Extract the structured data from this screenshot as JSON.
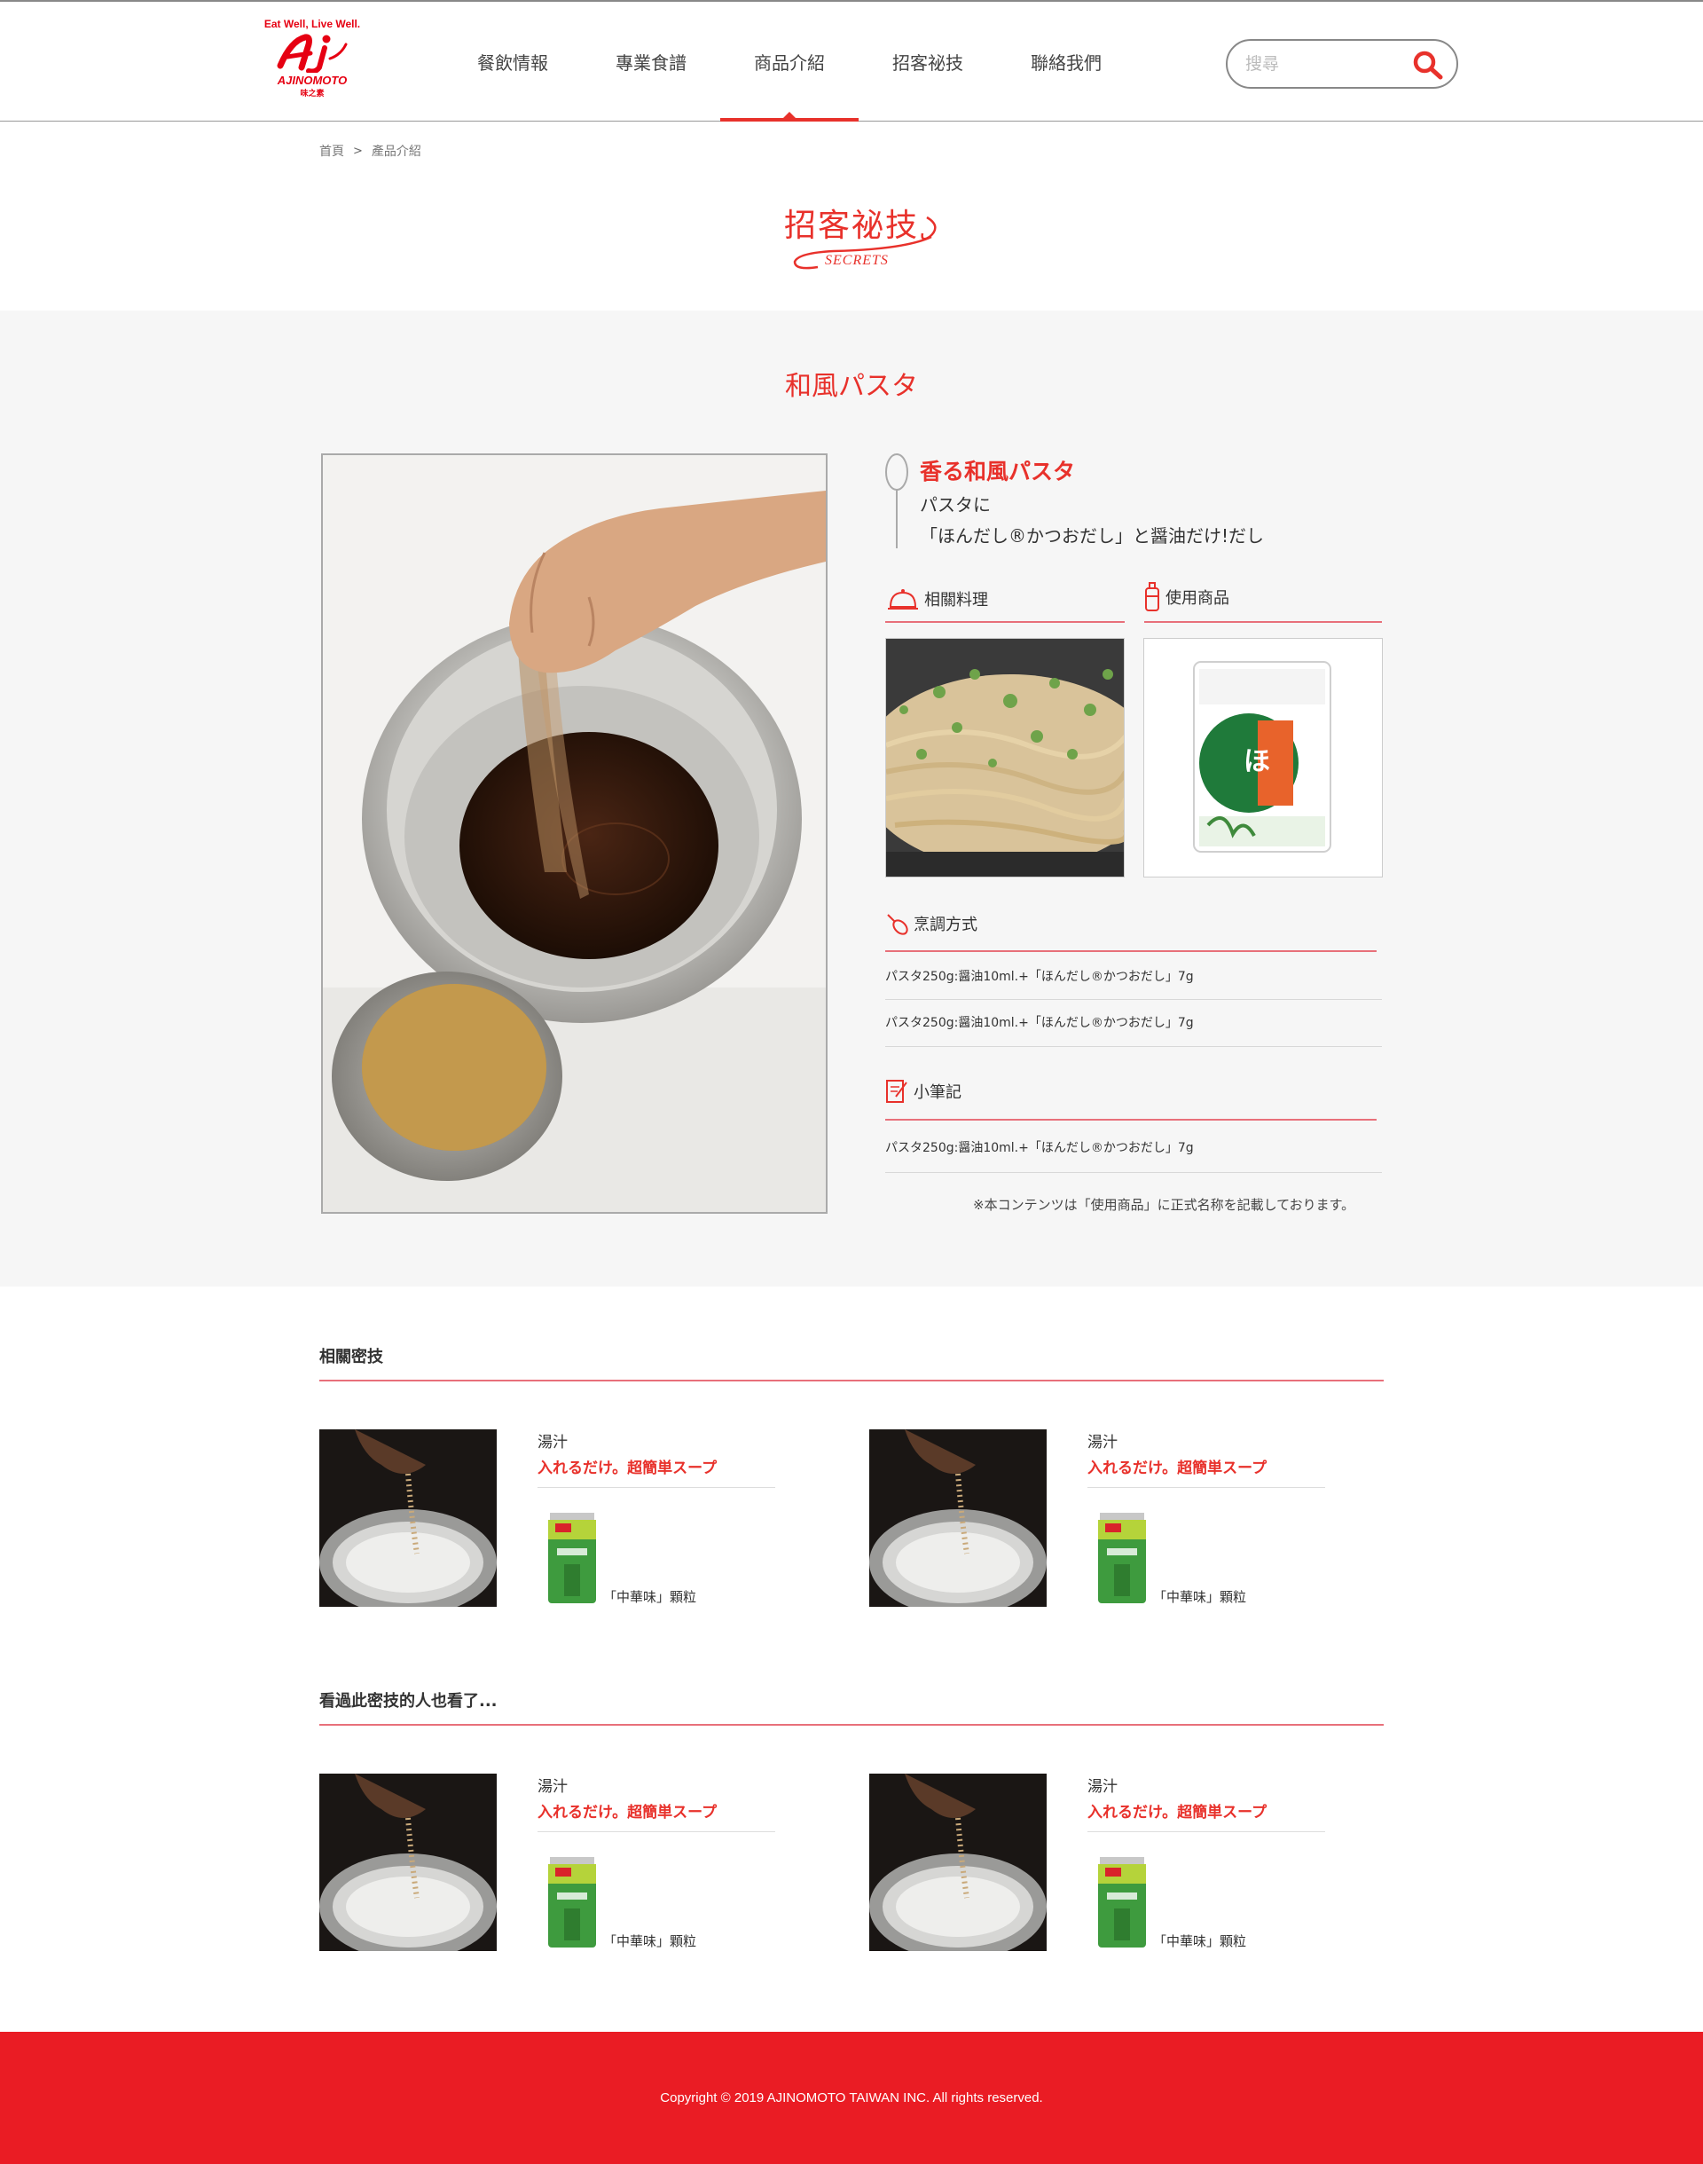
{
  "header": {
    "logo_tagline": "Eat Well, Live Well.",
    "logo_brand": "AJINOMOTO",
    "logo_brand_sub": "味之素",
    "nav": [
      {
        "label": "餐飲情報"
      },
      {
        "label": "專業食譜"
      },
      {
        "label": "商品介紹"
      },
      {
        "label": "招客祕技"
      },
      {
        "label": "聯絡我們"
      }
    ],
    "active_nav": "商品介紹",
    "search_placeholder": "搜尋"
  },
  "breadcrumb": {
    "home": "首頁",
    "separator": ">",
    "current": "產品介紹"
  },
  "page_title": {
    "cn": "招客祕技",
    "en": "SECRETS"
  },
  "main": {
    "heading": "和風パスタ",
    "tip_title": "香る和風パスタ",
    "tip_line1": "パスタに",
    "tip_line2": "「ほんだし®かつおだし」と醤油だけ!だし",
    "related_dish_label": "相關料理",
    "used_product_label": "使用商品",
    "cooking_method_label": "烹調方式",
    "cooking_steps": [
      "パスタ250g:醤油10ml.+「ほんだし®かつおだし」7g",
      "パスタ250g:醤油10ml.+「ほんだし®かつおだし」7g"
    ],
    "notes_label": "小筆記",
    "notes": [
      "パスタ250g:醤油10ml.+「ほんだし®かつおだし」7g"
    ],
    "disclaimer": "※本コンテンツは「使用商品」に正式名称を記載しております。",
    "product_package_text": "ほんだし"
  },
  "related_secrets": {
    "heading": "相關密技",
    "cards": [
      {
        "category": "湯汁",
        "title": "入れるだけ。超簡単スープ",
        "product": "「中華味」顆粒"
      },
      {
        "category": "湯汁",
        "title": "入れるだけ。超簡単スープ",
        "product": "「中華味」顆粒"
      }
    ]
  },
  "also_viewed": {
    "heading": "看過此密技的人也看了...",
    "cards": [
      {
        "category": "湯汁",
        "title": "入れるだけ。超簡単スープ",
        "product": "「中華味」顆粒"
      },
      {
        "category": "湯汁",
        "title": "入れるだけ。超簡単スープ",
        "product": "「中華味」顆粒"
      }
    ]
  },
  "footer": {
    "copyright": "Copyright © 2019 AJINOMOTO TAIWAN INC. All rights reserved."
  },
  "colors": {
    "brand_red": "#e8312b",
    "footer_red": "#ea1c24",
    "section_gray": "#f6f6f6"
  }
}
